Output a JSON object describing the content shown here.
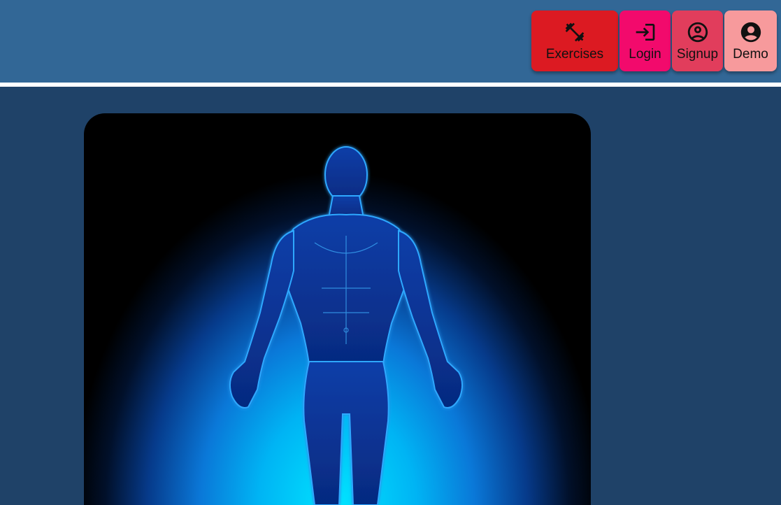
{
  "nav": {
    "items": [
      {
        "label": "Exercises",
        "icon": "dumbbell-icon",
        "color": "#dc1a22"
      },
      {
        "label": "Login",
        "icon": "login-icon",
        "color": "#f20a6c"
      },
      {
        "label": "Signup",
        "icon": "account-circle-outline-icon",
        "color": "#e13d5c"
      },
      {
        "label": "Demo",
        "icon": "account-circle-icon",
        "color": "#f79a9c"
      }
    ]
  },
  "colors": {
    "header_bg": "#326796",
    "page_bg": "#1f4268",
    "divider": "#ffffff"
  },
  "hero": {
    "image": "human-body-anatomy-figure-blue-glow"
  }
}
